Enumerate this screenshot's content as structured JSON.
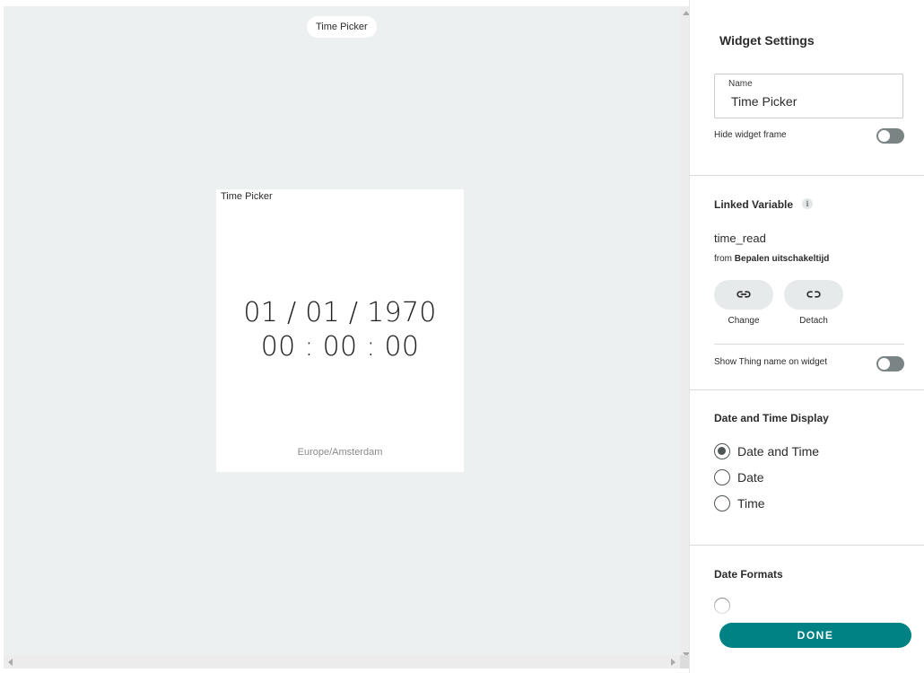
{
  "canvas": {
    "widget_pill_label": "Time Picker",
    "widget": {
      "title": "Time Picker",
      "date": "01 / 01 / 1970",
      "time": "00 : 00 : 00",
      "timezone": "Europe/Amsterdam"
    }
  },
  "settings": {
    "title": "Widget Settings",
    "name_field": {
      "label": "Name",
      "value": "Time Picker"
    },
    "hide_frame": {
      "label": "Hide widget frame",
      "on": false
    },
    "linked_variable": {
      "title": "Linked Variable",
      "info_icon": "i",
      "variable": "time_read",
      "from_prefix": "from",
      "from_thing": "Bepalen uitschakeltijd",
      "change_label": "Change",
      "detach_label": "Detach",
      "show_thing_name": {
        "label": "Show Thing name on widget",
        "on": false
      }
    },
    "display": {
      "title": "Date and Time Display",
      "options": [
        "Date and Time",
        "Date",
        "Time"
      ],
      "selected": "Date and Time"
    },
    "formats": {
      "title": "Date Formats"
    },
    "done_label": "DONE"
  },
  "colors": {
    "accent": "#008184",
    "canvas_bg": "#edf0f0",
    "toggle_off": "#7b8484"
  },
  "icons": [
    "link-icon",
    "unlink-icon",
    "info-icon",
    "scroll-arrow-icon"
  ]
}
